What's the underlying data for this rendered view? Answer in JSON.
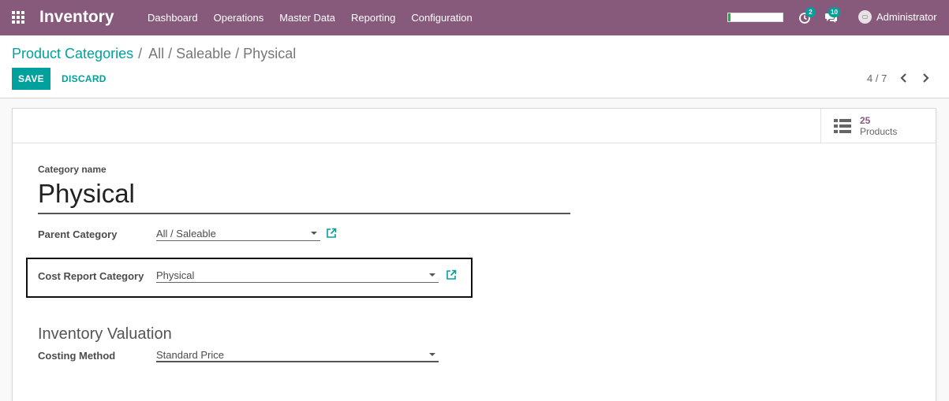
{
  "navbar": {
    "app_name": "Inventory",
    "menu": [
      "Dashboard",
      "Operations",
      "Master Data",
      "Reporting",
      "Configuration"
    ],
    "progress": 0.05,
    "activity_count": "2",
    "message_count": "10",
    "user_name": "Administrator"
  },
  "breadcrumb": {
    "parent": "Product Categories",
    "separator": "/",
    "current": "All / Saleable / Physical"
  },
  "buttons": {
    "save": "SAVE",
    "discard": "DISCARD"
  },
  "pager": {
    "value": "4 / 7"
  },
  "stat_button": {
    "value": "25",
    "label": "Products"
  },
  "form": {
    "category_name_label": "Category name",
    "category_name": "Physical",
    "parent_category_label": "Parent Category",
    "parent_category": "All / Saleable",
    "cost_report_label": "Cost Report Category",
    "cost_report": "Physical",
    "valuation_title": "Inventory Valuation",
    "costing_method_label": "Costing Method",
    "costing_method": "Standard Price"
  },
  "colors": {
    "navbar": "#875a7b",
    "accent": "#00a09d",
    "progress": "#28a745"
  }
}
